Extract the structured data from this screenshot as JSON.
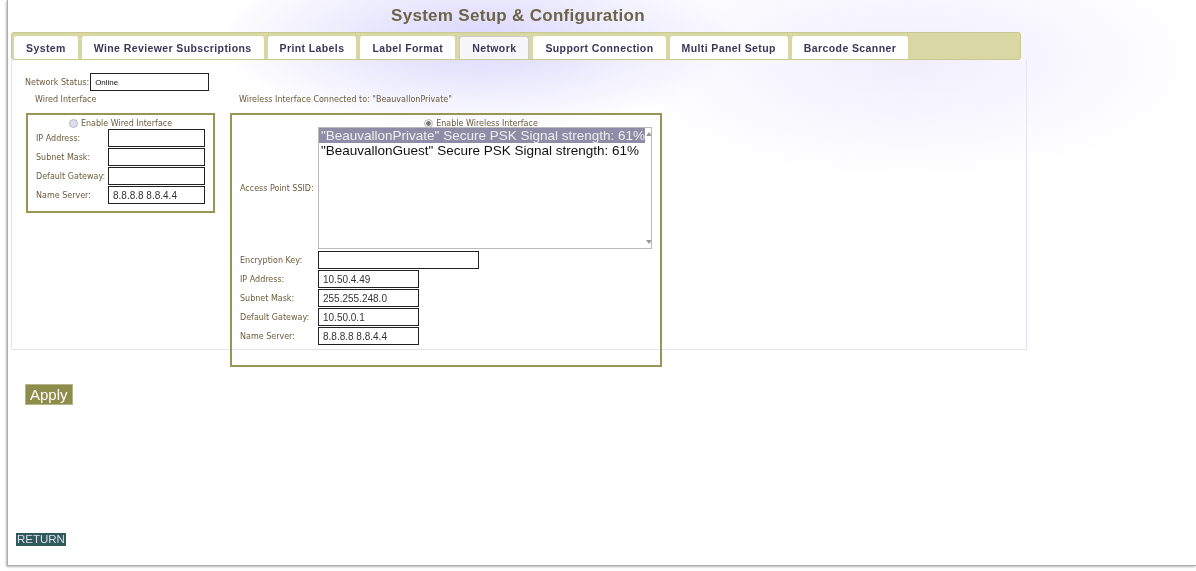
{
  "title": "System Setup & Configuration",
  "tabs": [
    {
      "label": "System",
      "selected": false
    },
    {
      "label": "Wine Reviewer Subscriptions",
      "selected": false
    },
    {
      "label": "Print Labels",
      "selected": false
    },
    {
      "label": "Label Format",
      "selected": false
    },
    {
      "label": "Network",
      "selected": true
    },
    {
      "label": "Support Connection",
      "selected": false
    },
    {
      "label": "Multi Panel Setup",
      "selected": false
    },
    {
      "label": "Barcode Scanner",
      "selected": false
    }
  ],
  "network_status": {
    "label": "Network Status:",
    "value": "Online"
  },
  "wired": {
    "heading": "Wired Interface",
    "enable": {
      "label": "Enable Wired Interface",
      "checked": false
    },
    "fields": [
      {
        "label": "IP Address:"
      },
      {
        "label": "Subnet Mask:"
      },
      {
        "label": "Default Gateway:"
      },
      {
        "label": "Name Server:",
        "value": "8.8.8.8 8.8.4.4"
      }
    ]
  },
  "wireless": {
    "heading": "Wireless Interface Connected to: \"BeauvallonPrivate\"",
    "enable": {
      "label": "Enable Wireless Interface",
      "checked": true
    },
    "ssid_label": "Access Point SSID:",
    "ssids": [
      {
        "label": "\"BeauvallonPrivate\" Secure PSK Signal strength: 61%",
        "selected": true
      },
      {
        "label": "\"BeauvallonGuest\" Secure PSK Signal strength: 61%",
        "selected": false
      }
    ],
    "fields": [
      {
        "label": "Encryption Key:",
        "kind": "wide"
      },
      {
        "label": "IP Address:",
        "value": "10.50.4.49",
        "kind": "short"
      },
      {
        "label": "Subnet Mask:",
        "value": "255.255.248.0",
        "kind": "short"
      },
      {
        "label": "Default Gateway:",
        "value": "10.50.0.1",
        "kind": "short"
      },
      {
        "label": "Name Server:",
        "value": "8.8.8.8 8.8.4.4",
        "kind": "short"
      }
    ]
  },
  "apply_button": "Apply",
  "return_button": "RETURN"
}
